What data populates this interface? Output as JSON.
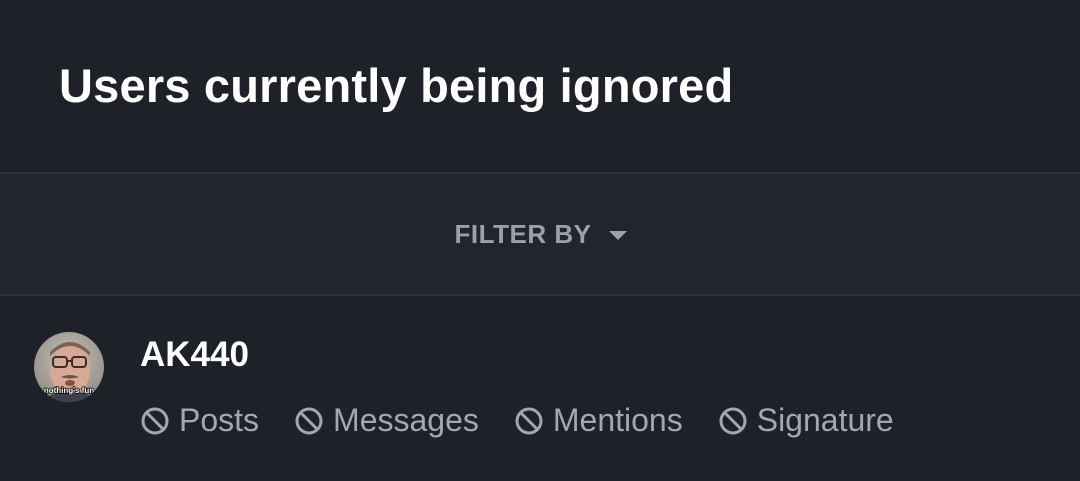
{
  "page": {
    "title": "Users currently being ignored"
  },
  "filter": {
    "label": "FILTER BY",
    "icon": "caret-down-icon"
  },
  "ignored_users": [
    {
      "username": "AK440",
      "avatar_caption": "nothing's fun",
      "options": [
        {
          "label": "Posts",
          "icon": "ban-icon"
        },
        {
          "label": "Messages",
          "icon": "ban-icon"
        },
        {
          "label": "Mentions",
          "icon": "ban-icon"
        },
        {
          "label": "Signature",
          "icon": "ban-icon"
        }
      ]
    }
  ],
  "colors": {
    "background": "#1f2128",
    "filter_bar": "#22252d",
    "divider": "#30333c",
    "muted_text": "#a3a7b0"
  }
}
